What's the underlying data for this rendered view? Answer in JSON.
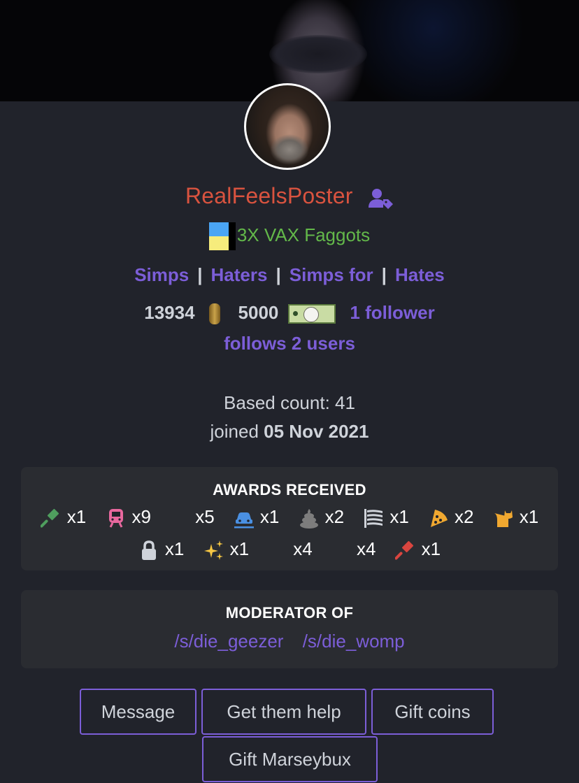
{
  "profile": {
    "username": "RealFeelsPoster",
    "flair_text": "3X VAX Faggots",
    "colors": {
      "username": "#d9533f",
      "flair": "#63b84a",
      "link": "#7c5ed8"
    }
  },
  "relations": {
    "items": [
      "Simps",
      "Haters",
      "Simps for",
      "Hates"
    ],
    "separator": "|"
  },
  "stats": {
    "coins": "13934",
    "marseybux": "5000",
    "followers": "1 follower",
    "following": "follows 2 users"
  },
  "info": {
    "based_count": "Based count: 41",
    "joined_label": "joined",
    "joined_date": "05 Nov 2021"
  },
  "awards": {
    "title": "AWARDS RECEIVED",
    "items": [
      {
        "icon": "gavel-icon",
        "color": "#4f9e5e",
        "count": "x1"
      },
      {
        "icon": "train-icon",
        "color": "#e8689e",
        "count": "x9"
      },
      {
        "icon": "blank-icon",
        "color": "",
        "count": "x5"
      },
      {
        "icon": "car-crash-icon",
        "color": "#4a90e2",
        "count": "x1"
      },
      {
        "icon": "poop-icon",
        "color": "#7d7d7d",
        "count": "x2"
      },
      {
        "icon": "flag-usa-icon",
        "color": "#cfd3da",
        "count": "x1"
      },
      {
        "icon": "pizza-icon",
        "color": "#f0a830",
        "count": "x2"
      },
      {
        "icon": "cat-icon",
        "color": "#f0a830",
        "count": "x1"
      },
      {
        "icon": "lock-icon",
        "color": "#cfd3da",
        "count": "x1"
      },
      {
        "icon": "sparkles-icon",
        "color": "#f6c744",
        "count": "x1"
      },
      {
        "icon": "blank-icon",
        "color": "",
        "count": "x4"
      },
      {
        "icon": "blank-icon",
        "color": "",
        "count": "x4"
      },
      {
        "icon": "gavel-icon",
        "color": "#d9453f",
        "count": "x1"
      }
    ]
  },
  "moderator": {
    "title": "MODERATOR OF",
    "subs": [
      "/s/die_geezer",
      "/s/die_womp"
    ]
  },
  "actions": {
    "message": "Message",
    "get_help": "Get them help",
    "gift_coins": "Gift coins",
    "gift_marseybux": "Gift Marseybux"
  }
}
